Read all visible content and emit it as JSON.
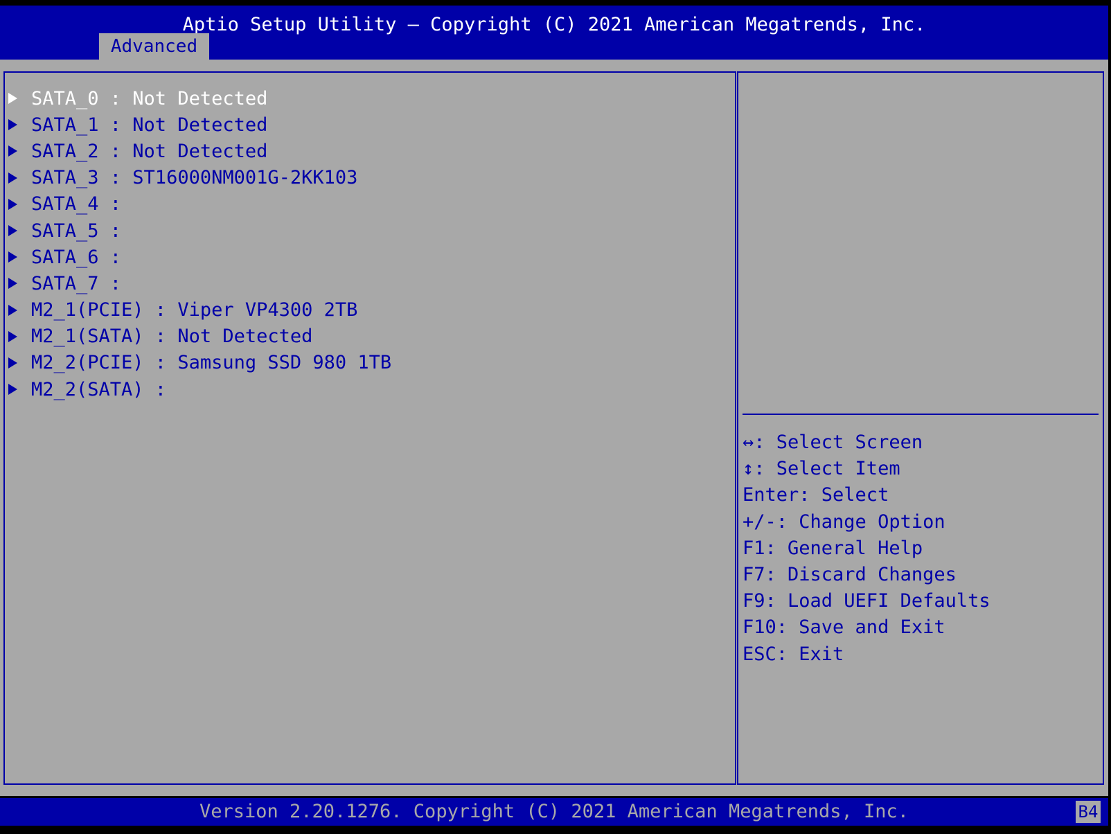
{
  "header": {
    "title": "Aptio Setup Utility – Copyright (C) 2021 American Megatrends, Inc.",
    "tabs": [
      {
        "label": "Advanced"
      }
    ]
  },
  "menu": {
    "items": [
      {
        "label": "SATA_0 : Not Detected"
      },
      {
        "label": "SATA_1 : Not Detected"
      },
      {
        "label": "SATA_2 : Not Detected"
      },
      {
        "label": "SATA_3 : ST16000NM001G-2KK103"
      },
      {
        "label": "SATA_4 :"
      },
      {
        "label": "SATA_5 :"
      },
      {
        "label": "SATA_6 :"
      },
      {
        "label": "SATA_7 :"
      },
      {
        "label": "M2_1(PCIE) : Viper VP4300 2TB"
      },
      {
        "label": "M2_1(SATA) : Not Detected"
      },
      {
        "label": "M2_2(PCIE) : Samsung SSD 980 1TB"
      },
      {
        "label": "M2_2(SATA) :"
      }
    ],
    "selected_index": 0
  },
  "help": {
    "keys": [
      {
        "label": "↔: Select Screen"
      },
      {
        "label": "↕: Select Item"
      },
      {
        "label": "Enter: Select"
      },
      {
        "label": "+/-: Change Option"
      },
      {
        "label": "F1: General Help"
      },
      {
        "label": "F7: Discard Changes"
      },
      {
        "label": "F9: Load UEFI Defaults"
      },
      {
        "label": "F10: Save and Exit"
      },
      {
        "label": "ESC: Exit"
      }
    ]
  },
  "footer": {
    "version": "Version 2.20.1276. Copyright (C) 2021 American Megatrends, Inc.",
    "code": "B4"
  },
  "colors": {
    "background_blue": "#0000a8",
    "panel_gray": "#a8a8a8",
    "selected_text": "#ffffff",
    "normal_text": "#0000a8"
  },
  "icons": {
    "menu_item_marker": "submenu-arrow-icon"
  }
}
